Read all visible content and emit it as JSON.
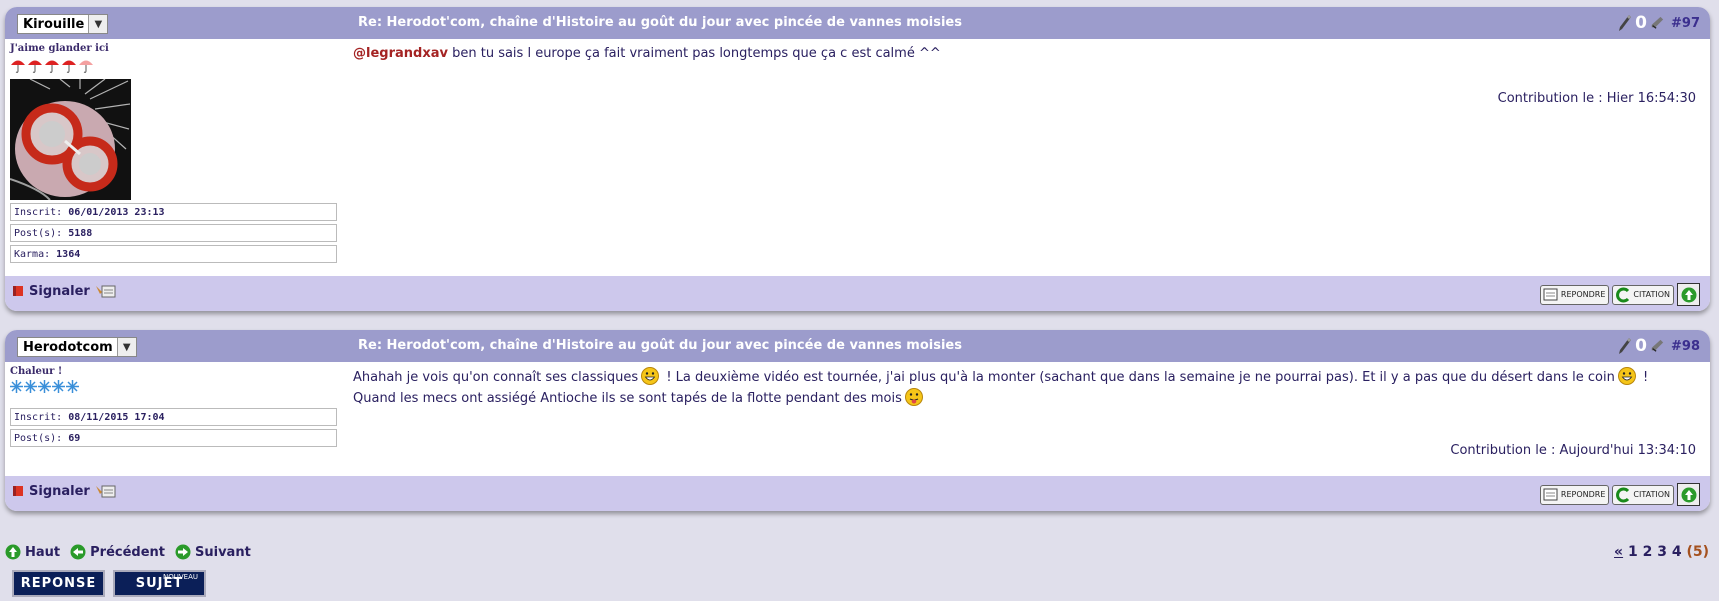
{
  "posts": [
    {
      "author": "Kirouille",
      "title": "Re: Herodot'com, chaîne d'Histoire au goût du jour avec pincée de vannes moisies",
      "vote_count": "0",
      "number": "#97",
      "rank": "J'aime glander ici",
      "inscrit_label": "Inscrit:",
      "inscrit": "06/01/2013 23:13",
      "posts_label": "Post(s):",
      "posts_count": "5188",
      "karma_label": "Karma:",
      "karma": "1364",
      "mention": "@legrandxav",
      "message": " ben tu sais l europe ça fait vraiment pas longtemps que ça c est calmé ^^",
      "contribution": "Contribution le : Hier 16:54:30"
    },
    {
      "author": "Herodotcom",
      "title": "Re: Herodot'com, chaîne d'Histoire au goût du jour avec pincée de vannes moisies",
      "vote_count": "0",
      "number": "#98",
      "rank": "Chaleur !",
      "inscrit_label": "Inscrit:",
      "inscrit": "08/11/2015 17:04",
      "posts_label": "Post(s):",
      "posts_count": "69",
      "message_part1": "Ahahah je vois qu'on connaît ses classiques",
      "message_part2": " ! La deuxième vidéo est tournée, j'ai plus qu'à la monter (sachant que dans la semaine je ne pourrai pas). Et il y a pas que du désert dans le coin",
      "message_part3": " ! Quand les mecs ont assiégé Antioche ils se sont tapés de la flotte pendant des mois",
      "contribution": "Contribution le : Aujourd'hui 13:34:10"
    }
  ],
  "footer": {
    "signal": "Signaler",
    "reply_btn": "REPONDRE",
    "quote_btn": "CITATION"
  },
  "nav": {
    "top": "Haut",
    "prev": "Précédent",
    "next": "Suivant"
  },
  "pager": {
    "prev": "«",
    "pages": [
      "1",
      "2",
      "3",
      "4"
    ],
    "current": "(5)"
  },
  "buttons": {
    "reply": "REPONSE",
    "new_small": "NOUVEAU",
    "new": "SUJET"
  },
  "colors": {
    "header": "#9c9ccc",
    "footer": "#cdc8ec",
    "mention": "#a42323",
    "page_bg": "#e0dfeb"
  }
}
